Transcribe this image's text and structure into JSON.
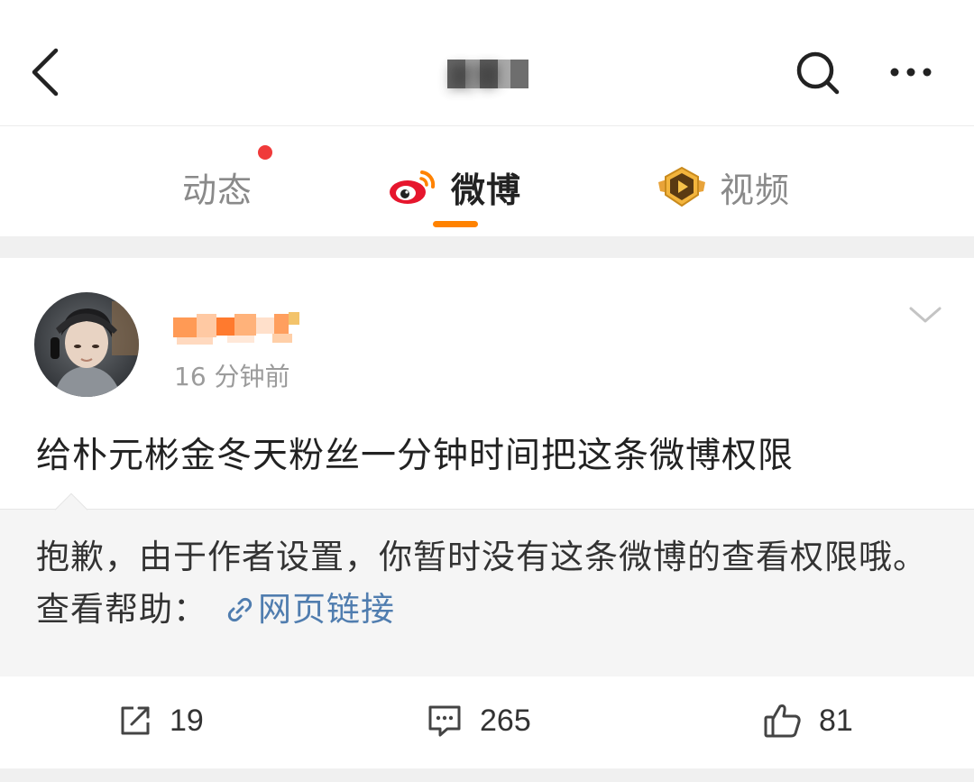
{
  "header": {
    "title": "麦草",
    "back_icon": "chevron-left-icon",
    "search_icon": "search-icon",
    "more_icon": "more-dots-icon"
  },
  "tabs": [
    {
      "label": "动态",
      "has_badge": true,
      "active": false
    },
    {
      "label": "微博",
      "icon": "weibo-logo-icon",
      "active": true
    },
    {
      "label": "视频",
      "icon": "video-badge-icon",
      "active": false
    }
  ],
  "post": {
    "time": "16 分钟前",
    "text": "给朴元彬金冬天粉丝一分钟时间把这条微博权限",
    "notice_text": "抱歉，由于作者设置，你暂时没有这条微博的查看权限哦。查看帮助：",
    "notice_link": "网页链接",
    "actions": {
      "repost_count": "19",
      "comment_count": "265",
      "like_count": "81"
    }
  },
  "colors": {
    "accent": "#ff8200",
    "badge_red": "#f03a3a",
    "link_blue": "#507daf"
  }
}
